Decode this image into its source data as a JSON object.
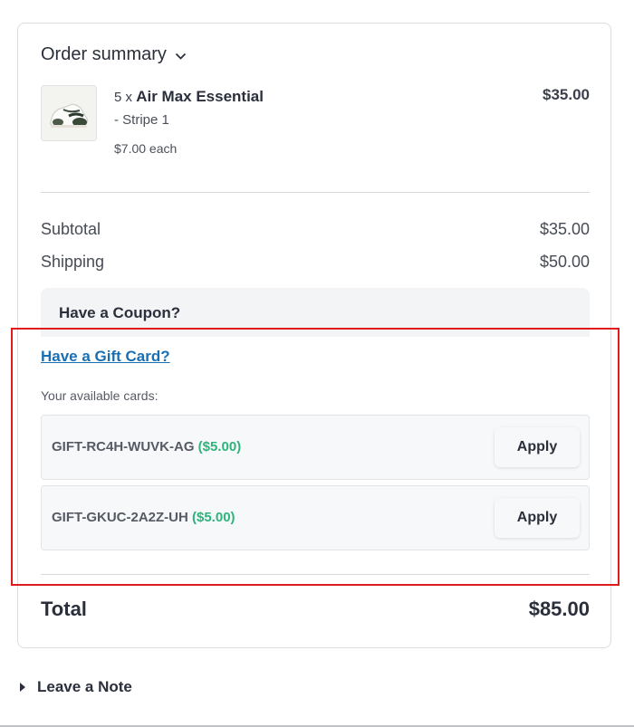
{
  "summary": {
    "title": "Order summary"
  },
  "product": {
    "quantity_prefix": "5 x",
    "name": "Air Max Essential",
    "variant": "- Stripe 1",
    "unit_price": "$7.00 each",
    "line_total": "$35.00"
  },
  "totals": {
    "subtotal_label": "Subtotal",
    "subtotal_value": "$35.00",
    "shipping_label": "Shipping",
    "shipping_value": "$50.00",
    "total_label": "Total",
    "total_value": "$85.00"
  },
  "coupon": {
    "label": "Have a Coupon?"
  },
  "gift": {
    "link_label": "Have a Gift Card?",
    "available_label": "Your available cards:",
    "cards": [
      {
        "code": "GIFT-RC4H-WUVK-AG",
        "amount": "($5.00)",
        "button": "Apply"
      },
      {
        "code": "GIFT-GKUC-2A2Z-UH",
        "amount": "($5.00)",
        "button": "Apply"
      }
    ]
  },
  "note": {
    "label": "Leave a Note"
  },
  "colors": {
    "link": "#1a6fb3",
    "gift_amount": "#2eb37c",
    "highlight": "#e01b1b"
  }
}
